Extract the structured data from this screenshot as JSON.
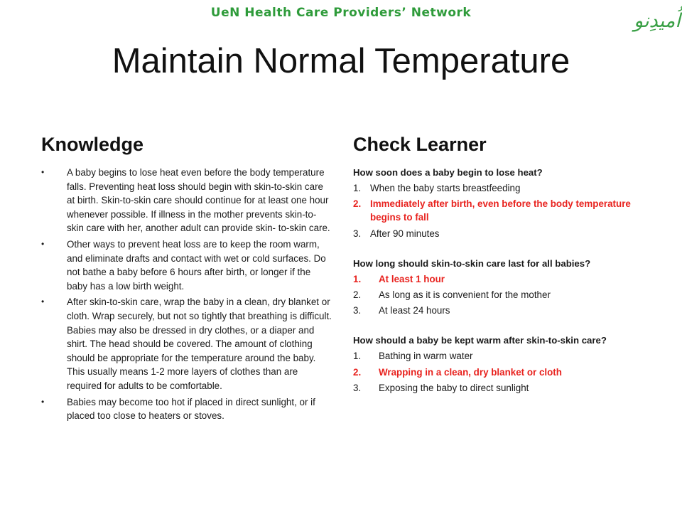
{
  "header": {
    "network": "UeN Health Care Providers’ Network",
    "logo_text": "اُمیدِنو",
    "title": "Maintain Normal Temperature"
  },
  "knowledge": {
    "heading": "Knowledge",
    "bullet_symbol": "•",
    "items": [
      "A baby begins to lose heat even before the body temperature falls. Preventing heat loss should begin with skin-to-skin care at birth. Skin-to-skin care should continue for at least one hour whenever possible. If illness in the mother prevents skin-to- skin care with her, another adult can provide skin- to-skin care.",
      "Other ways to prevent heat loss are to keep the room warm, and eliminate drafts and contact with wet or cold surfaces. Do not bathe a baby before 6 hours after birth, or longer if the baby has a low birth weight.",
      "After skin-to-skin care, wrap the baby in a clean, dry blanket or cloth. Wrap securely, but not so tightly that breathing is difficult. Babies may also be dressed in dry clothes, or a diaper and shirt. The head should be covered. The amount of clothing should be appropriate for the temperature around the baby. This usually means 1-2 more layers of clothes than are required for adults to be comfortable.",
      "Babies may become too hot if placed in direct sunlight, or if placed too close to heaters or stoves."
    ]
  },
  "check_learner": {
    "heading": "Check Learner",
    "correct_color": "#e8221e",
    "questions": [
      {
        "question": "How soon does a baby begin to lose heat?",
        "answers": [
          {
            "num": "1.",
            "text": "When the baby starts breastfeeding"
          },
          {
            "num": "2.",
            "text": "Immediately after birth, even before the body temperature begins to fall"
          },
          {
            "num": "3.",
            "text": "After 90 minutes"
          }
        ]
      },
      {
        "question": "How long should skin-to-skin care last for all babies?",
        "answers": [
          {
            "num": "1.",
            "text": "At least 1 hour"
          },
          {
            "num": "2.",
            "text": "As long as it is convenient for the mother"
          },
          {
            "num": "3.",
            "text": "At least 24 hours"
          }
        ]
      },
      {
        "question": "How should a baby be kept warm after skin-to-skin care?",
        "answers": [
          {
            "num": "1.",
            "text": "Bathing in warm water"
          },
          {
            "num": "2.",
            "text": "Wrapping in a clean, dry blanket or cloth"
          },
          {
            "num": "3.",
            "text": "Exposing the baby to direct sunlight"
          }
        ]
      }
    ]
  }
}
